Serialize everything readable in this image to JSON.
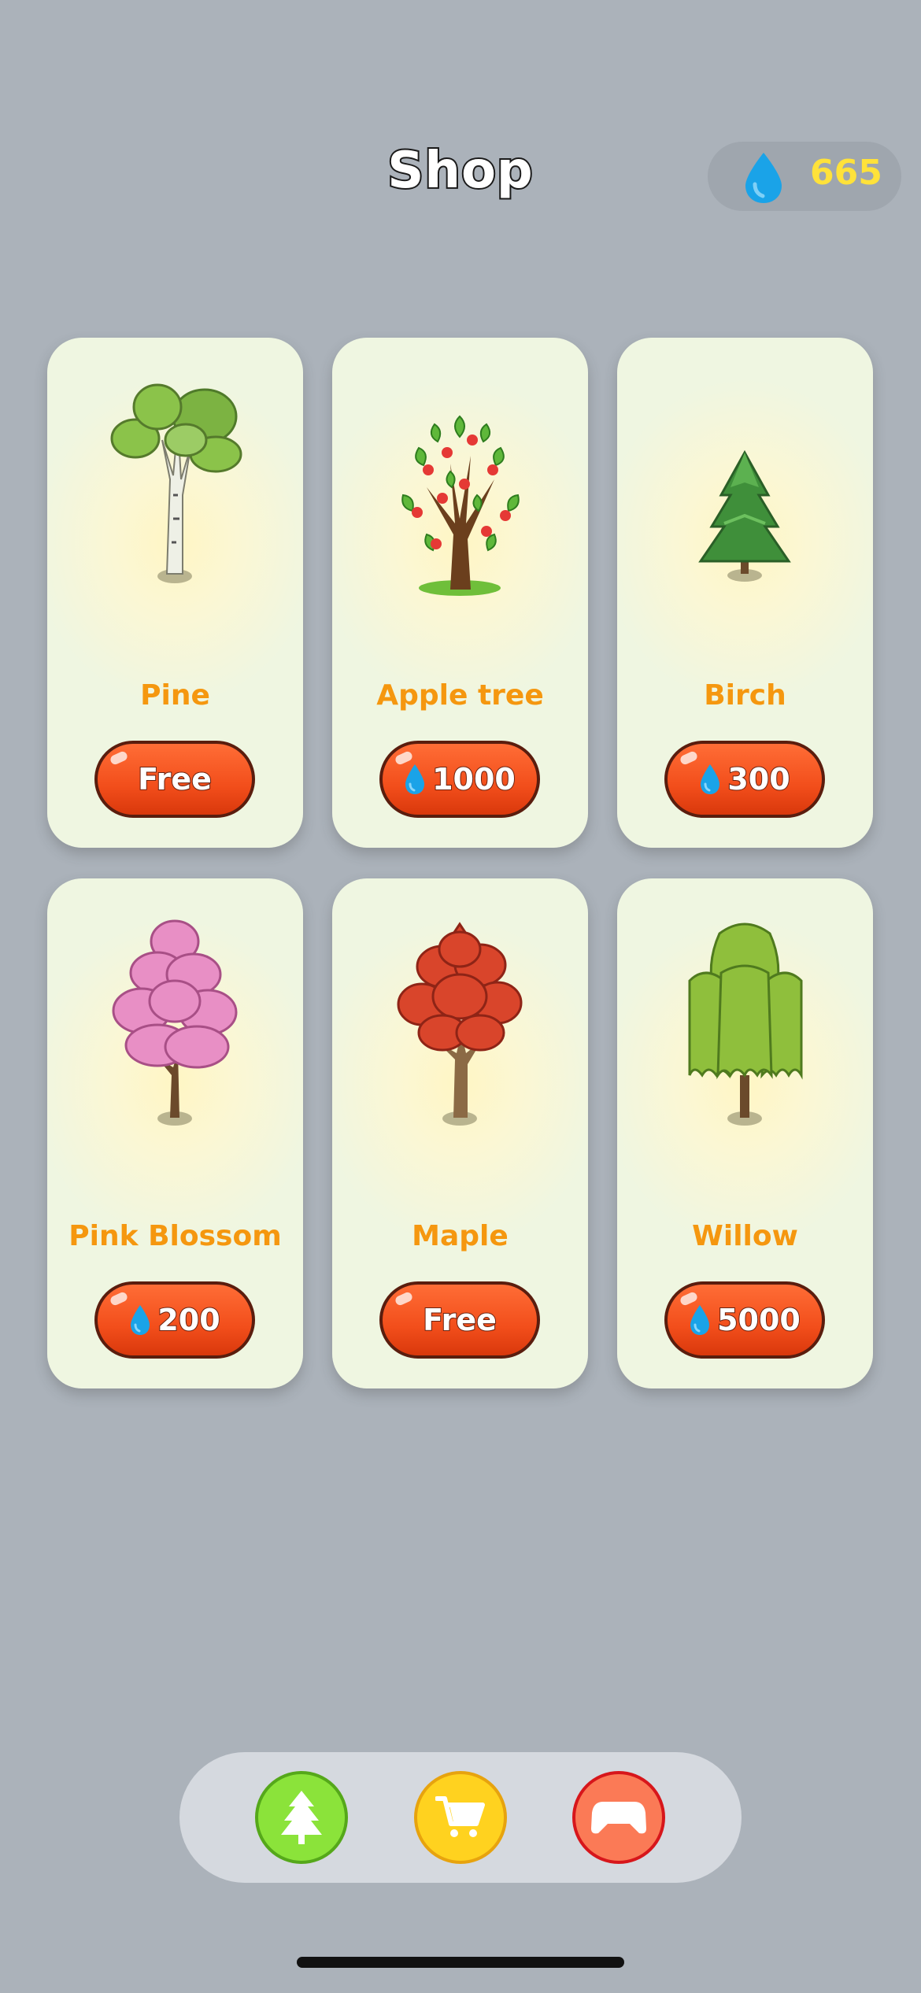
{
  "header": {
    "title": "Shop",
    "currency": {
      "icon": "water-drop-icon",
      "amount": "665"
    }
  },
  "items": [
    {
      "name": "Pine",
      "price_label": "Free",
      "has_drop": false
    },
    {
      "name": "Apple tree",
      "price_label": "1000",
      "has_drop": true
    },
    {
      "name": "Birch",
      "price_label": "300",
      "has_drop": true
    },
    {
      "name": "Pink Blossom",
      "price_label": "200",
      "has_drop": true
    },
    {
      "name": "Maple",
      "price_label": "Free",
      "has_drop": false
    },
    {
      "name": "Willow",
      "price_label": "5000",
      "has_drop": true
    }
  ],
  "nav": [
    {
      "icon": "tree-icon",
      "color": "#8be33a"
    },
    {
      "icon": "cart-icon",
      "color": "#ffd21f"
    },
    {
      "icon": "gamepad-icon",
      "color": "#fb7a56"
    }
  ],
  "colors": {
    "accent": "#f24e1b",
    "name_text": "#f5970f",
    "currency_text": "#ffe23a"
  }
}
